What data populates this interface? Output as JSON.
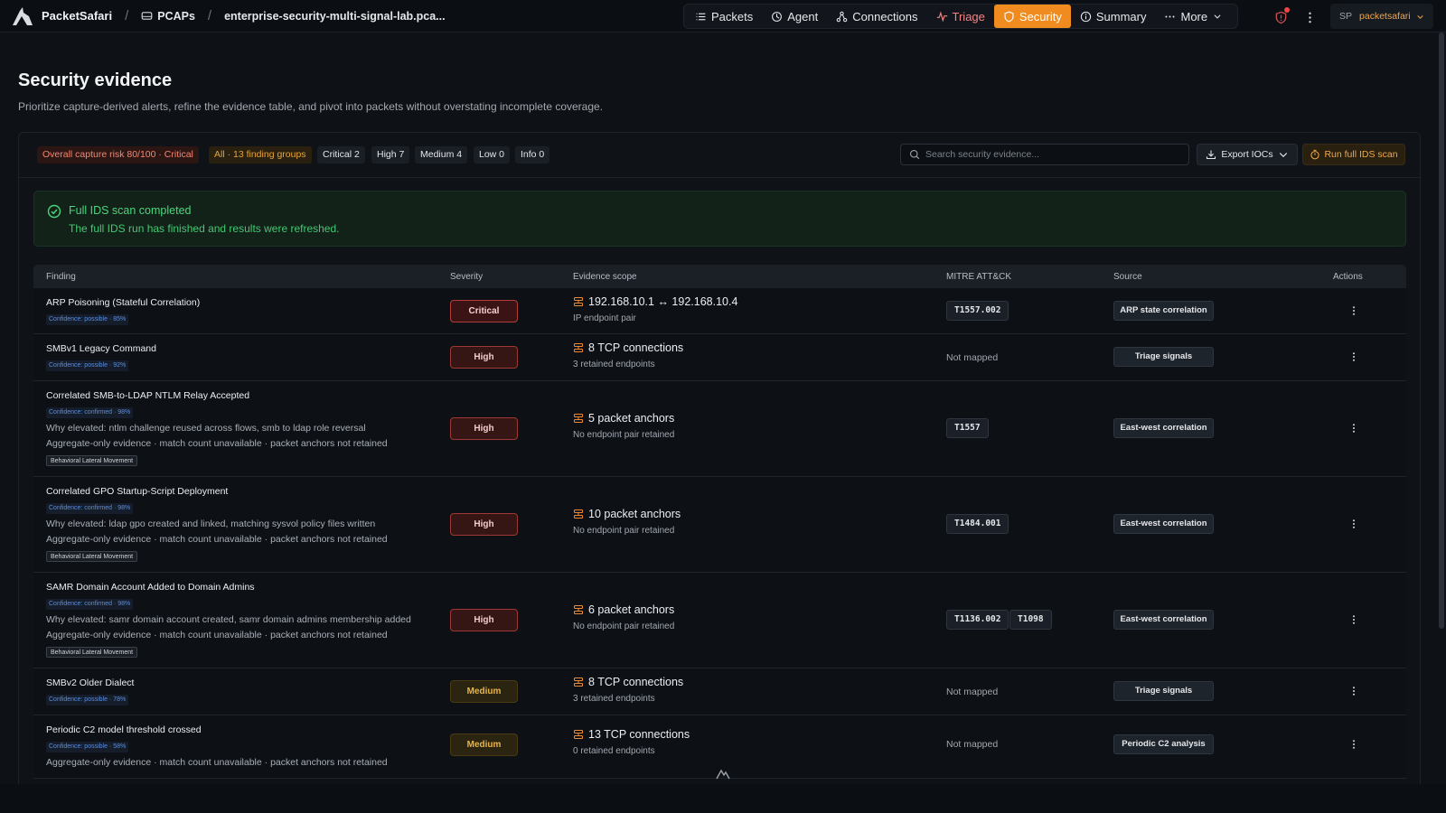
{
  "app": {
    "name": "PacketSafari",
    "breadcrumbs": [
      "PCAPs",
      "enterprise-security-multi-signal-lab.pca..."
    ]
  },
  "nav": {
    "items": [
      {
        "label": "Packets",
        "icon": "list-icon"
      },
      {
        "label": "Agent",
        "icon": "agent-icon"
      },
      {
        "label": "Connections",
        "icon": "connections-icon"
      },
      {
        "label": "Triage",
        "icon": "activity-icon"
      },
      {
        "label": "Security",
        "icon": "shield-icon",
        "active": true
      },
      {
        "label": "Summary",
        "icon": "info-icon"
      },
      {
        "label": "More",
        "icon": "ellipsis-icon"
      }
    ]
  },
  "user": {
    "initials": "SP",
    "name": "packetsafari"
  },
  "page": {
    "title": "Security evidence",
    "subtitle": "Prioritize capture-derived alerts, refine the evidence table, and pivot into packets without overstating incomplete coverage."
  },
  "filters": {
    "risk": "Overall capture risk 80/100 · Critical",
    "all": "All · 13 finding groups",
    "critical": "Critical 2",
    "high": "High 7",
    "medium": "Medium 4",
    "low": "Low 0",
    "info": "Info 0"
  },
  "search": {
    "placeholder": "Search security evidence...",
    "value": ""
  },
  "actions": {
    "export": "Export IOCs",
    "run_ids": "Run full IDS scan"
  },
  "alert": {
    "title": "Full IDS scan completed",
    "body": "The full IDS run has finished and results were refreshed."
  },
  "table": {
    "headers": {
      "finding": "Finding",
      "severity": "Severity",
      "scope": "Evidence scope",
      "mitre": "MITRE ATT&CK",
      "source": "Source",
      "actions": "Actions"
    },
    "rows": [
      {
        "finding": "ARP Poisoning (Stateful Correlation)",
        "confidence": "Confidence: possible · 85%",
        "severity": "Critical",
        "scope": "192.168.10.1 ↔ 192.168.10.4",
        "scope_sub": "IP endpoint pair",
        "mitre": [
          "T1557.002"
        ],
        "source": "ARP state correlation"
      },
      {
        "finding": "SMBv1 Legacy Command",
        "confidence": "Confidence: possible · 92%",
        "severity": "High",
        "scope": "8 TCP connections",
        "scope_sub": "3 retained endpoints",
        "mitre_none": "Not mapped",
        "source": "Triage signals"
      },
      {
        "finding": "Correlated SMB-to-LDAP NTLM Relay Accepted",
        "confidence": "Confidence: confirmed · 98%",
        "why": "Why elevated: ntlm challenge reused across flows, smb to ldap role reversal",
        "agg": "Aggregate-only evidence · match count unavailable · packet anchors not retained",
        "tag": "Behavioral Lateral Movement",
        "severity": "High",
        "scope": "5 packet anchors",
        "scope_sub": "No endpoint pair retained",
        "mitre": [
          "T1557"
        ],
        "source": "East-west correlation"
      },
      {
        "finding": "Correlated GPO Startup-Script Deployment",
        "confidence": "Confidence: confirmed · 98%",
        "why": "Why elevated: ldap gpo created and linked, matching sysvol policy files written",
        "agg": "Aggregate-only evidence · match count unavailable · packet anchors not retained",
        "tag": "Behavioral Lateral Movement",
        "severity": "High",
        "scope": "10 packet anchors",
        "scope_sub": "No endpoint pair retained",
        "mitre": [
          "T1484.001"
        ],
        "source": "East-west correlation"
      },
      {
        "finding": "SAMR Domain Account Added to Domain Admins",
        "confidence": "Confidence: confirmed · 98%",
        "why": "Why elevated: samr domain account created, samr domain admins membership added",
        "agg": "Aggregate-only evidence · match count unavailable · packet anchors not retained",
        "tag": "Behavioral Lateral Movement",
        "severity": "High",
        "scope": "6 packet anchors",
        "scope_sub": "No endpoint pair retained",
        "mitre": [
          "T1136.002",
          "T1098"
        ],
        "source": "East-west correlation"
      },
      {
        "finding": "SMBv2 Older Dialect",
        "confidence": "Confidence: possible · 78%",
        "severity": "Medium",
        "scope": "8 TCP connections",
        "scope_sub": "3 retained endpoints",
        "mitre_none": "Not mapped",
        "source": "Triage signals"
      },
      {
        "finding": "Periodic C2 model threshold crossed",
        "confidence": "Confidence: possible · 58%",
        "agg": "Aggregate-only evidence · match count unavailable · packet anchors not retained",
        "severity": "Medium",
        "scope": "13 TCP connections",
        "scope_sub": "0 retained endpoints",
        "mitre_none": "Not mapped",
        "source": "Periodic C2 analysis"
      }
    ]
  },
  "colors": {
    "accent": "#f08c1f",
    "critical": "#b43b3b",
    "success": "#4ad67c"
  }
}
